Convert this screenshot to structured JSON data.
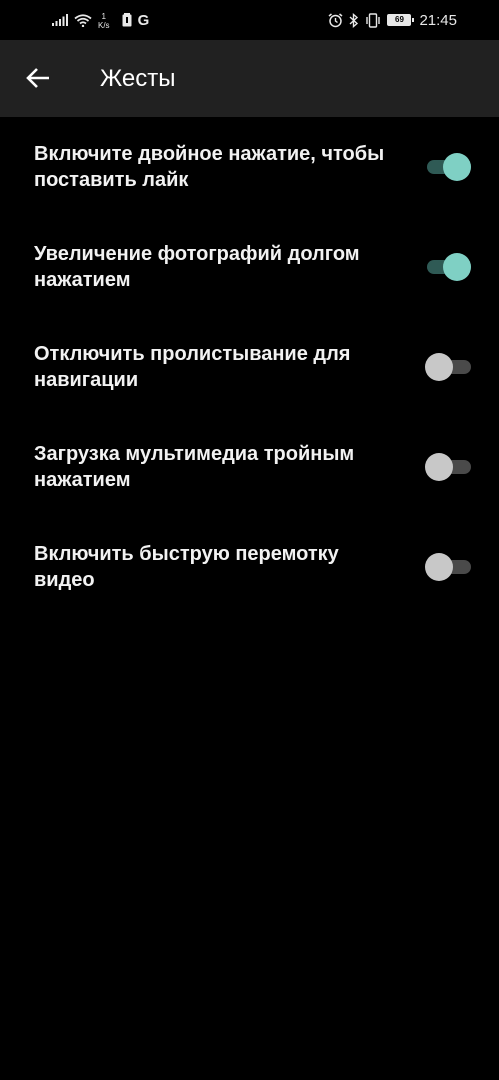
{
  "status_bar": {
    "net_speed_value": "1",
    "net_speed_unit": "K/s",
    "g_letter": "G",
    "battery": "69",
    "time": "21:45",
    "icons": [
      "signal-icon",
      "wifi-icon",
      "battery-saver-icon",
      "google-icon",
      "alarm-icon",
      "bluetooth-icon",
      "vibrate-icon",
      "battery-icon"
    ]
  },
  "appbar": {
    "title": "Жесты",
    "back_icon": "arrow-left-icon"
  },
  "settings": [
    {
      "label": "Включите двойное нажатие, чтобы поставить лайк",
      "enabled": true
    },
    {
      "label": "Увеличение фотографий долгом нажатием",
      "enabled": true
    },
    {
      "label": "Отключить пролистывание для навигации",
      "enabled": false
    },
    {
      "label": "Загрузка мультимедиа тройным нажатием",
      "enabled": false
    },
    {
      "label": "Включить быструю перемотку видео",
      "enabled": false
    }
  ],
  "colors": {
    "background": "#000000",
    "appbar": "#212121",
    "toggle_on_thumb": "#7fd0c4",
    "toggle_on_track": "#2f5a55",
    "toggle_off_thumb": "#c8c8c8",
    "toggle_off_track": "#4a4a4a"
  }
}
